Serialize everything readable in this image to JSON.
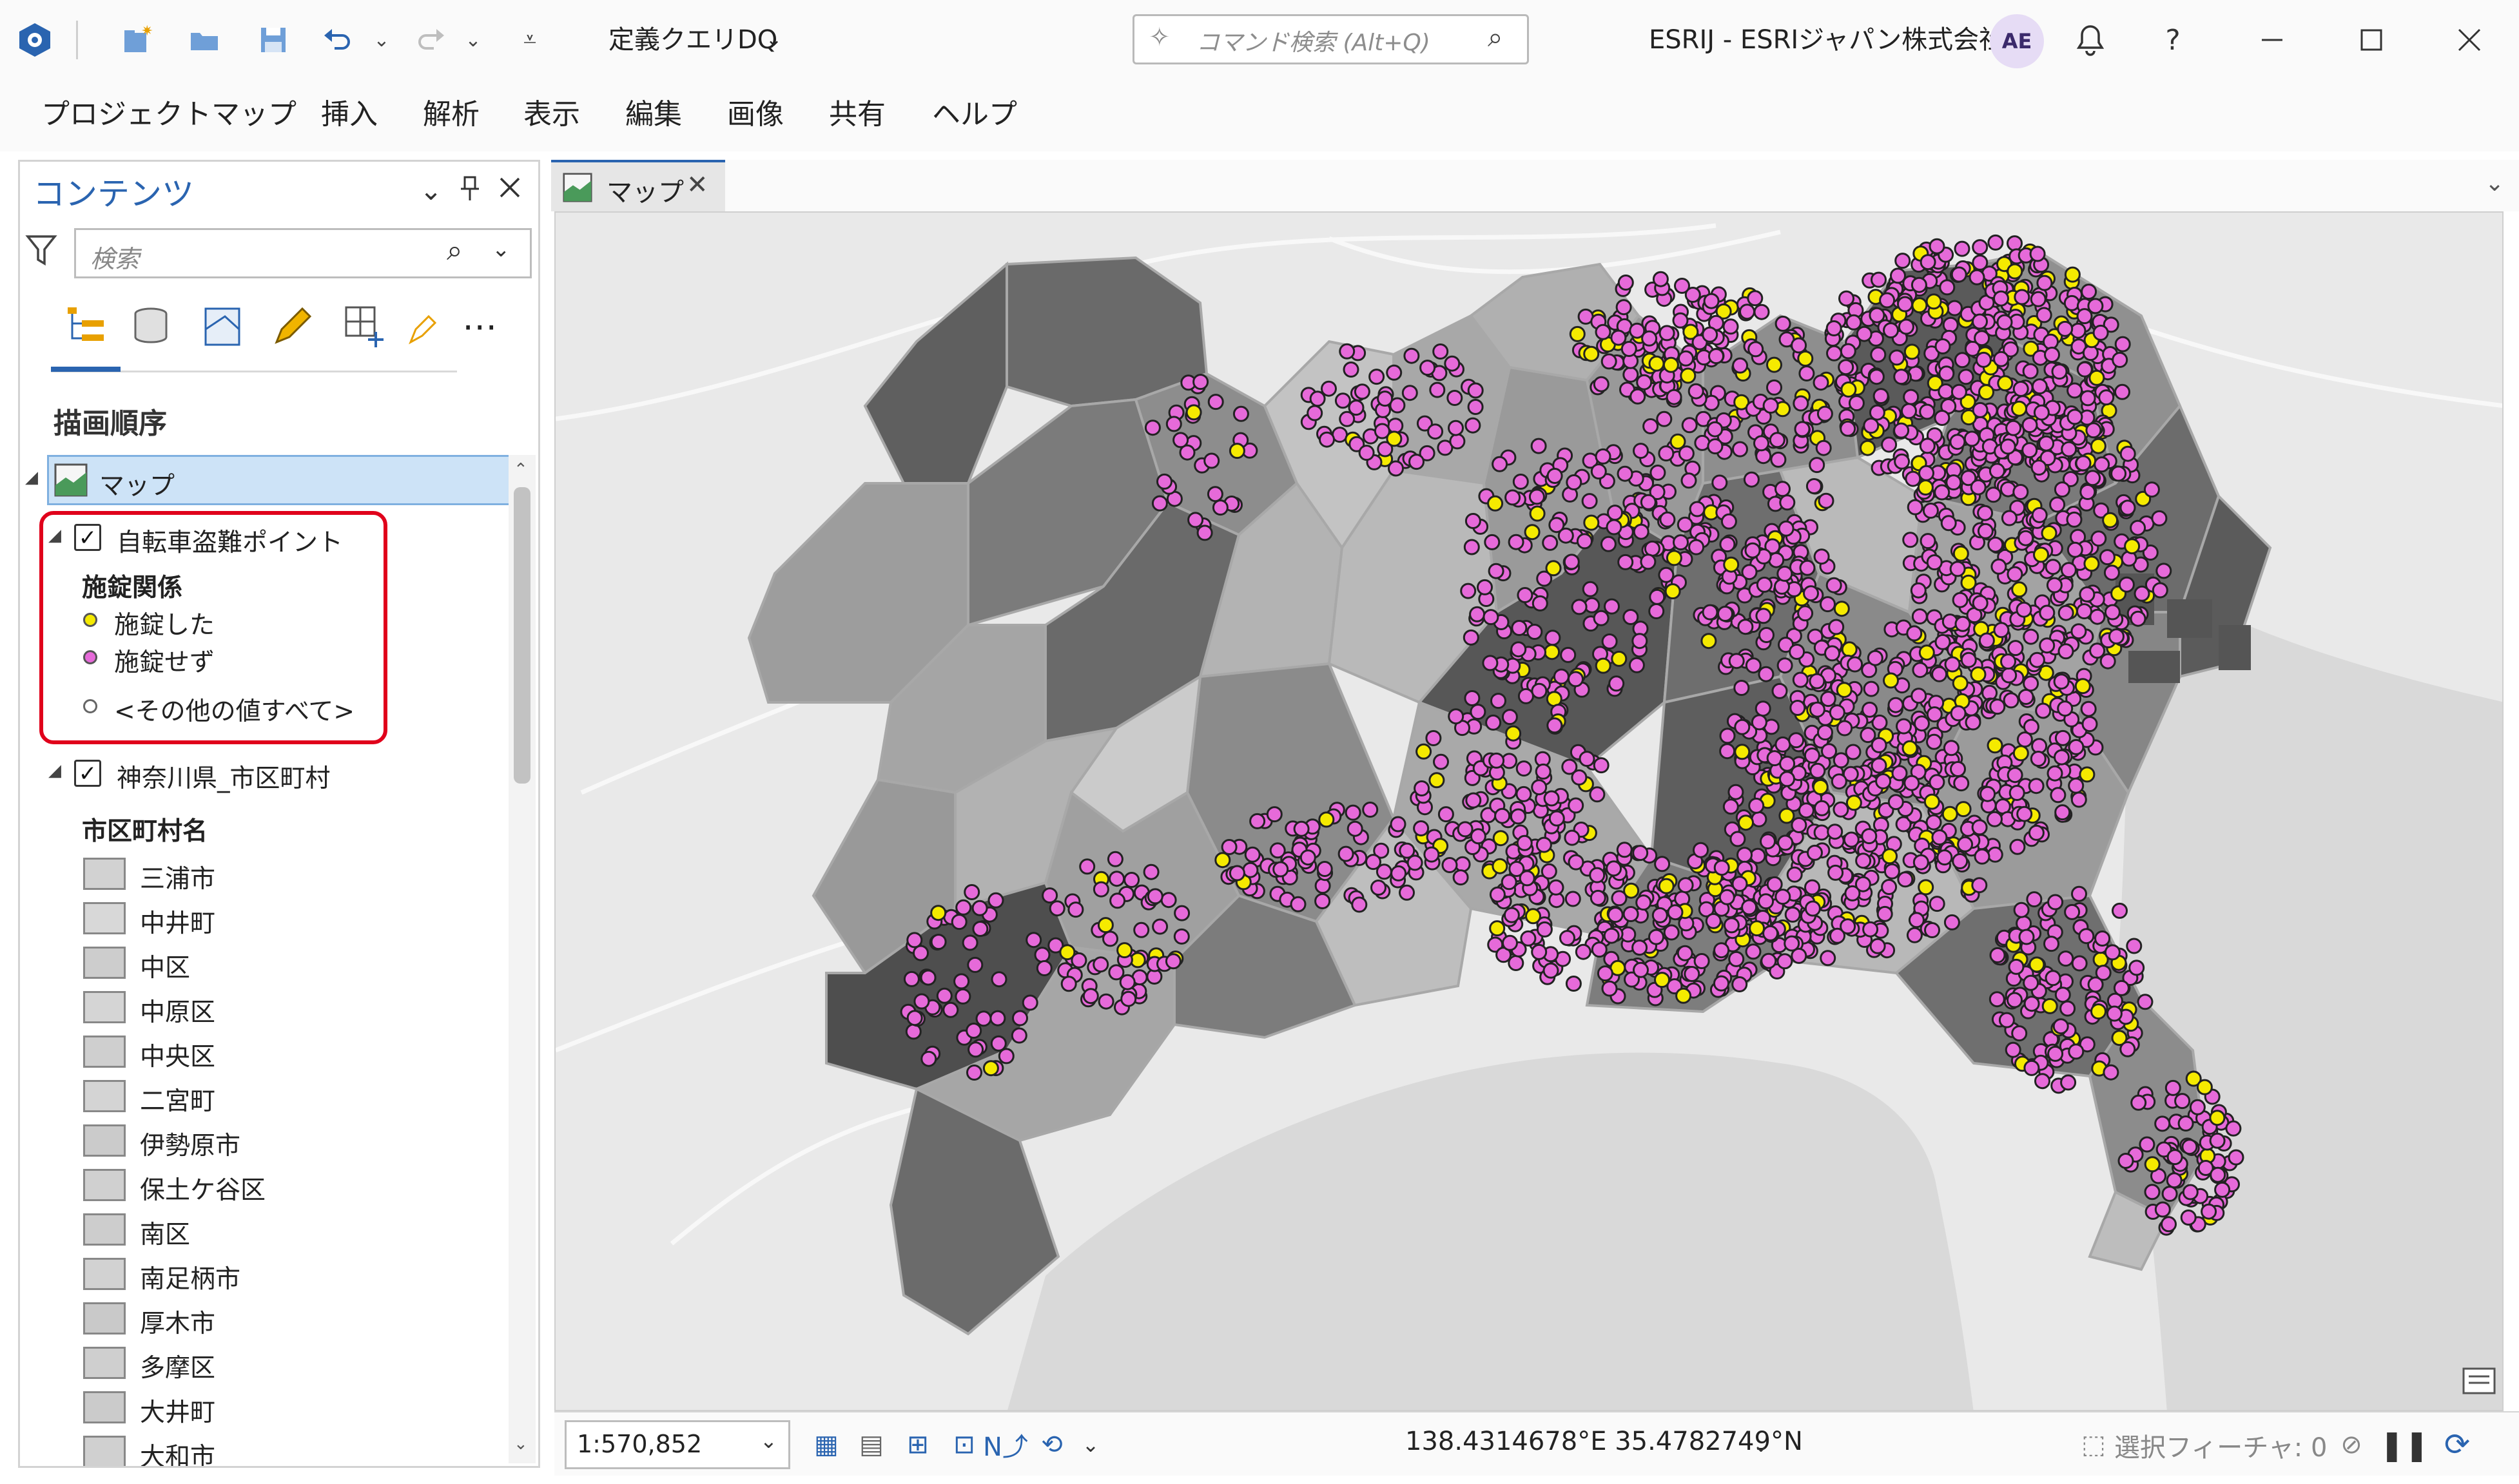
{
  "titlebar": {
    "project_name": "定義クエリDQ",
    "search_placeholder": "コマンド検索 (Alt+Q)",
    "account": "ESRIJ - ESRIジャパン株式会社",
    "avatar_initials": "AE",
    "help": "?"
  },
  "ribbon": {
    "tabs": [
      "プロジェクト",
      "マップ",
      "挿入",
      "解析",
      "表示",
      "編集",
      "画像",
      "共有",
      "ヘルプ"
    ]
  },
  "contents": {
    "title": "コンテンツ",
    "search_placeholder": "検索",
    "section_title": "描画順序",
    "map_item": "マップ",
    "layer1": {
      "name": "自転車盗難ポイント",
      "field": "施錠関係",
      "classes": [
        {
          "label": "施錠した",
          "color": "#f5ea00"
        },
        {
          "label": "施錠せず",
          "color": "#e66ad9"
        },
        {
          "label": "<その他の値すべて>",
          "color": "#ffffff"
        }
      ]
    },
    "layer2": {
      "name": "神奈川県_市区町村",
      "field": "市区町村名",
      "items": [
        "三浦市",
        "中井町",
        "中区",
        "中原区",
        "中央区",
        "二宮町",
        "伊勢原市",
        "保土ケ谷区",
        "南区",
        "南足柄市",
        "厚木市",
        "多摩区",
        "大井町",
        "大和市"
      ]
    }
  },
  "map": {
    "tab_label": "マップ",
    "scale": "1:570,852",
    "coordinates": "138.4314678°E 35.4782749°N",
    "selected_features": "選択フィーチャ: 0"
  },
  "colors": {
    "locked": "#f5ea00",
    "unlocked": "#e66ad9",
    "highlight": "#e0001b",
    "accent": "#2a64b0"
  }
}
